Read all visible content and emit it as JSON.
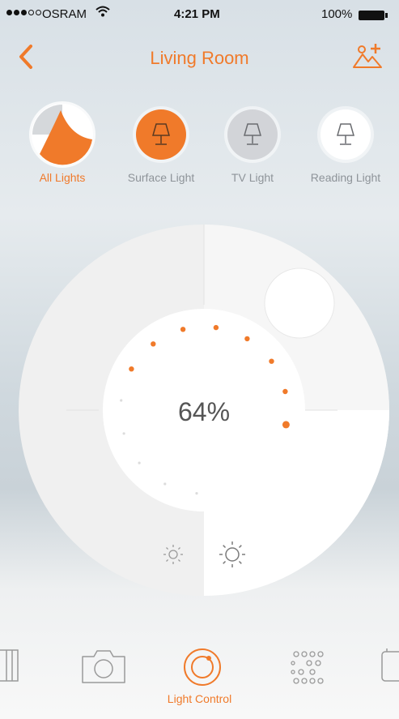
{
  "status_bar": {
    "carrier": "OSRAM",
    "time": "4:21 PM",
    "battery": "100%"
  },
  "nav": {
    "title": "Living Room",
    "back_icon": "chevron-left-icon",
    "add_icon": "add-scene-icon"
  },
  "lights": [
    {
      "label": "All Lights",
      "icon": "all-lights-icon",
      "state": "selected"
    },
    {
      "label": "Surface Light",
      "icon": "lamp-icon",
      "state": "on"
    },
    {
      "label": "TV Light",
      "icon": "lamp-icon",
      "state": "dim"
    },
    {
      "label": "Reading Light",
      "icon": "lamp-icon",
      "state": "off"
    }
  ],
  "dial": {
    "value_label": "64%",
    "brightness_level": 0.64,
    "low_icon": "sun-small-icon",
    "high_icon": "sun-large-icon"
  },
  "tabbar": {
    "active_label": "Light Control",
    "tabs": [
      {
        "icon": "grid-partial-icon"
      },
      {
        "icon": "camera-icon"
      },
      {
        "icon": "light-control-icon"
      },
      {
        "icon": "dots-pattern-icon"
      },
      {
        "icon": "pages-partial-icon"
      }
    ]
  },
  "colors": {
    "accent": "#f07a2a",
    "inactive_text": "#8e9499"
  }
}
